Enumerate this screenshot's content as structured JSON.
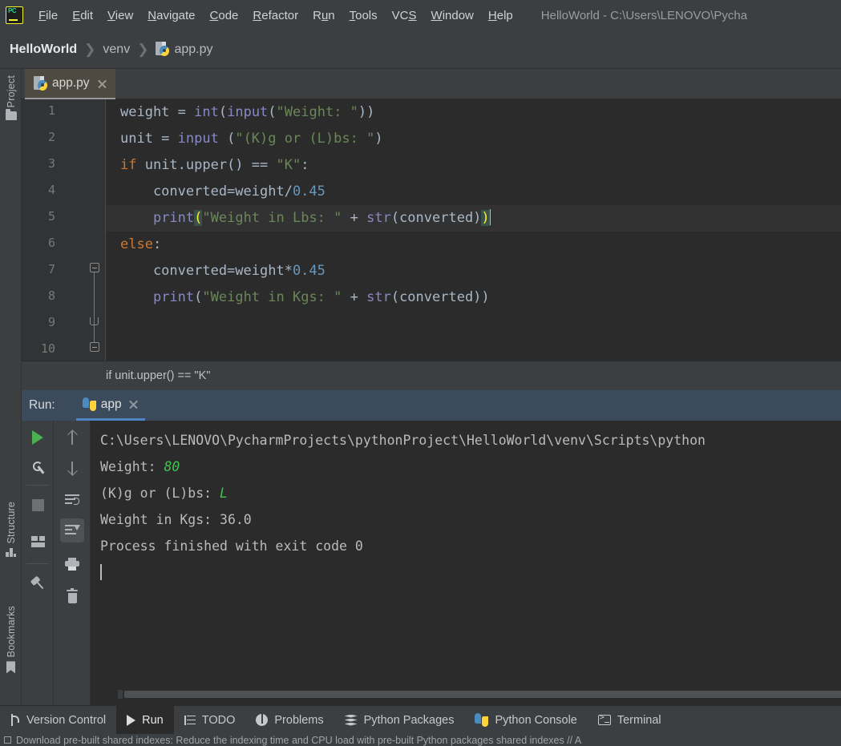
{
  "window": {
    "title": "HelloWorld - C:\\Users\\LENOVO\\Pycha",
    "app_icon": "pycharm-logo-icon"
  },
  "menubar": {
    "items": [
      {
        "label": "File",
        "mnemonic": "F"
      },
      {
        "label": "Edit",
        "mnemonic": "E"
      },
      {
        "label": "View",
        "mnemonic": "V"
      },
      {
        "label": "Navigate",
        "mnemonic": "N"
      },
      {
        "label": "Code",
        "mnemonic": "C"
      },
      {
        "label": "Refactor",
        "mnemonic": "R"
      },
      {
        "label": "Run",
        "mnemonic": "u"
      },
      {
        "label": "Tools",
        "mnemonic": "T"
      },
      {
        "label": "VCS",
        "mnemonic": "S"
      },
      {
        "label": "Window",
        "mnemonic": "W"
      },
      {
        "label": "Help",
        "mnemonic": "H"
      }
    ]
  },
  "breadcrumb": {
    "project": "HelloWorld",
    "folder": "venv",
    "file": "app.py",
    "separator": "❯"
  },
  "left_strip": {
    "tabs": [
      {
        "label": "Project",
        "icon": "folder-icon"
      },
      {
        "label": "Structure",
        "icon": "structure-icon"
      },
      {
        "label": "Bookmarks",
        "icon": "bookmark-icon"
      }
    ]
  },
  "editor": {
    "tab": {
      "label": "app.py",
      "icon": "python-file-icon",
      "close": "×"
    },
    "line_numbers": [
      "1",
      "2",
      "3",
      "4",
      "5",
      "6",
      "7",
      "8",
      "9",
      "10"
    ],
    "current_line": 5,
    "breadcrumb_text": "if unit.upper() == \"K\"",
    "code": [
      {
        "n": 1,
        "tokens": [
          {
            "t": "weight ",
            "c": "plain"
          },
          {
            "t": "= ",
            "c": "plain"
          },
          {
            "t": "int",
            "c": "bi"
          },
          {
            "t": "(",
            "c": "plain"
          },
          {
            "t": "input",
            "c": "bi"
          },
          {
            "t": "(",
            "c": "plain"
          },
          {
            "t": "\"Weight: \"",
            "c": "st"
          },
          {
            "t": "))",
            "c": "plain"
          }
        ]
      },
      {
        "n": 2,
        "tokens": [
          {
            "t": "unit = ",
            "c": "plain"
          },
          {
            "t": "input",
            "c": "bi"
          },
          {
            "t": " (",
            "c": "plain"
          },
          {
            "t": "\"(K)g or (L)bs: \"",
            "c": "st"
          },
          {
            "t": ")",
            "c": "plain"
          }
        ]
      },
      {
        "n": 3,
        "tokens": [
          {
            "t": "if",
            "c": "kw"
          },
          {
            "t": " unit.upper() == ",
            "c": "plain"
          },
          {
            "t": "\"K\"",
            "c": "st"
          },
          {
            "t": ":",
            "c": "plain"
          }
        ]
      },
      {
        "n": 4,
        "tokens": [
          {
            "t": "    converted=weight/",
            "c": "plain"
          },
          {
            "t": "0.45",
            "c": "num"
          }
        ]
      },
      {
        "n": 5,
        "tokens": [
          {
            "t": "    ",
            "c": "plain"
          },
          {
            "t": "print",
            "c": "bi"
          },
          {
            "t": "(",
            "c": "brk-hl"
          },
          {
            "t": "\"Weight in Lbs: \"",
            "c": "st"
          },
          {
            "t": " + ",
            "c": "plain"
          },
          {
            "t": "str",
            "c": "bi"
          },
          {
            "t": "(converted)",
            "c": "plain"
          },
          {
            "t": ")",
            "c": "brk-hl"
          }
        ]
      },
      {
        "n": 6,
        "tokens": [
          {
            "t": "else",
            "c": "kw"
          },
          {
            "t": ":",
            "c": "plain"
          }
        ]
      },
      {
        "n": 7,
        "tokens": [
          {
            "t": "    converted=weight*",
            "c": "plain"
          },
          {
            "t": "0.45",
            "c": "num"
          }
        ]
      },
      {
        "n": 8,
        "tokens": [
          {
            "t": "    ",
            "c": "plain"
          },
          {
            "t": "print",
            "c": "bi"
          },
          {
            "t": "(",
            "c": "plain"
          },
          {
            "t": "\"Weight in Kgs: \"",
            "c": "st"
          },
          {
            "t": " + ",
            "c": "plain"
          },
          {
            "t": "str",
            "c": "bi"
          },
          {
            "t": "(converted))",
            "c": "plain"
          }
        ]
      },
      {
        "n": 9,
        "tokens": []
      },
      {
        "n": 10,
        "tokens": []
      }
    ]
  },
  "run_panel": {
    "label": "Run:",
    "tab": {
      "label": "app",
      "icon": "python-icon",
      "close": "×"
    },
    "toolbar_left": [
      {
        "name": "rerun-button",
        "icon": "play-icon"
      },
      {
        "name": "settings-button",
        "icon": "wrench-icon"
      },
      {
        "name": "stop-button",
        "icon": "stop-icon"
      },
      {
        "name": "layout-button",
        "icon": "layout-icon"
      },
      {
        "name": "pin-tab-button",
        "icon": "pin-icon"
      }
    ],
    "toolbar_right": [
      {
        "name": "up-button",
        "icon": "arrow-up-icon"
      },
      {
        "name": "down-button",
        "icon": "arrow-down-icon"
      },
      {
        "name": "soft-wrap-button",
        "icon": "soft-wrap-icon"
      },
      {
        "name": "scroll-to-end-button",
        "icon": "scroll-to-end-icon",
        "selected": true
      },
      {
        "name": "print-button",
        "icon": "print-icon"
      },
      {
        "name": "clear-all-button",
        "icon": "trash-icon"
      }
    ],
    "console": [
      {
        "text": "C:\\Users\\LENOVO\\PycharmProjects\\pythonProject\\HelloWorld\\venv\\Scripts\\python",
        "input": ""
      },
      {
        "text": "Weight: ",
        "input": "80"
      },
      {
        "text": "(K)g or (L)bs: ",
        "input": "L"
      },
      {
        "text": "Weight in Kgs: 36.0",
        "input": ""
      },
      {
        "text": "",
        "input": ""
      },
      {
        "text": "Process finished with exit code 0",
        "input": ""
      }
    ]
  },
  "bottom_bar": {
    "tabs": [
      {
        "label": "Version Control",
        "icon": "branch-icon",
        "active": false
      },
      {
        "label": "Run",
        "icon": "play-icon",
        "active": true
      },
      {
        "label": "TODO",
        "icon": "list-icon",
        "active": false
      },
      {
        "label": "Problems",
        "icon": "info-icon",
        "active": false
      },
      {
        "label": "Python Packages",
        "icon": "packages-icon",
        "active": false
      },
      {
        "label": "Python Console",
        "icon": "python-icon",
        "active": false
      },
      {
        "label": "Terminal",
        "icon": "terminal-icon",
        "active": false
      }
    ]
  },
  "notification": {
    "text": "Download pre-built shared indexes: Reduce the indexing time and CPU load with pre-built Python packages shared indexes // A"
  },
  "colors": {
    "background": "#3c3f41",
    "editor_bg": "#2b2b2b",
    "keyword": "#cc7832",
    "string": "#6a8759",
    "number": "#6897bb",
    "builtin": "#8888c6",
    "default_text": "#a9b7c6",
    "run_header": "#3c4b5c",
    "accent": "#4e84c4",
    "run_green": "#4caf50",
    "input_green": "#40c452"
  }
}
